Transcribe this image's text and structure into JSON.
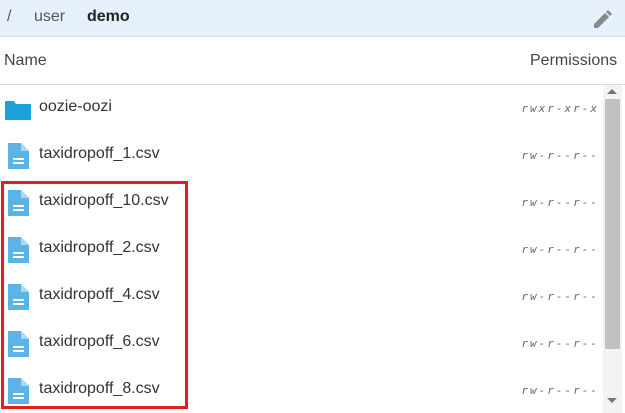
{
  "breadcrumb": {
    "separator": "/",
    "user": "user",
    "current": "demo"
  },
  "columns": {
    "name": "Name",
    "permissions": "Permissions"
  },
  "files": [
    {
      "name": "oozie-oozi",
      "type": "folder",
      "permissions": "rwxr-xr-x"
    },
    {
      "name": "taxidropoff_1.csv",
      "type": "file",
      "permissions": "rw-r--r--"
    },
    {
      "name": "taxidropoff_10.csv",
      "type": "file",
      "permissions": "rw-r--r--"
    },
    {
      "name": "taxidropoff_2.csv",
      "type": "file",
      "permissions": "rw-r--r--"
    },
    {
      "name": "taxidropoff_4.csv",
      "type": "file",
      "permissions": "rw-r--r--"
    },
    {
      "name": "taxidropoff_6.csv",
      "type": "file",
      "permissions": "rw-r--r--"
    },
    {
      "name": "taxidropoff_8.csv",
      "type": "file",
      "permissions": "rw-r--r--"
    }
  ],
  "colors": {
    "folder": "#1ba1dc",
    "file": "#5bb4e5",
    "highlight": "#e02020",
    "breadcrumb_bg": "#e6f1fb"
  }
}
